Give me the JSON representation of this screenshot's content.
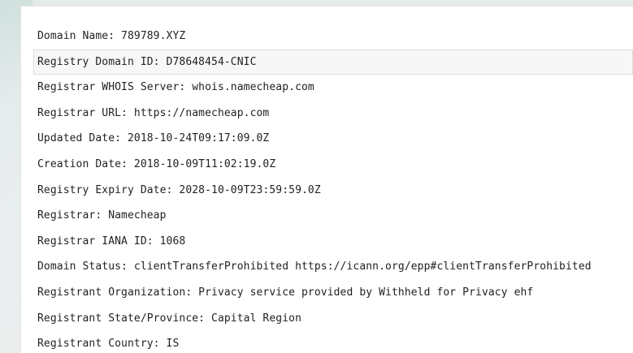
{
  "whois": {
    "lines": [
      "Domain Name: 789789.XYZ",
      "Registry Domain ID: D78648454-CNIC",
      "Registrar WHOIS Server: whois.namecheap.com",
      "Registrar URL: https://namecheap.com",
      "Updated Date: 2018-10-24T09:17:09.0Z",
      "Creation Date: 2018-10-09T11:02:19.0Z",
      "Registry Expiry Date: 2028-10-09T23:59:59.0Z",
      "Registrar: Namecheap",
      "Registrar IANA ID: 1068",
      "Domain Status: clientTransferProhibited https://icann.org/epp#clientTransferProhibited",
      "Registrant Organization: Privacy service provided by Withheld for Privacy ehf",
      "Registrant State/Province: Capital Region",
      "Registrant Country: IS"
    ]
  },
  "colors": {
    "text": "#222222",
    "highlight_bg": "#f7f7f7",
    "highlight_border": "#dcdcdc"
  }
}
